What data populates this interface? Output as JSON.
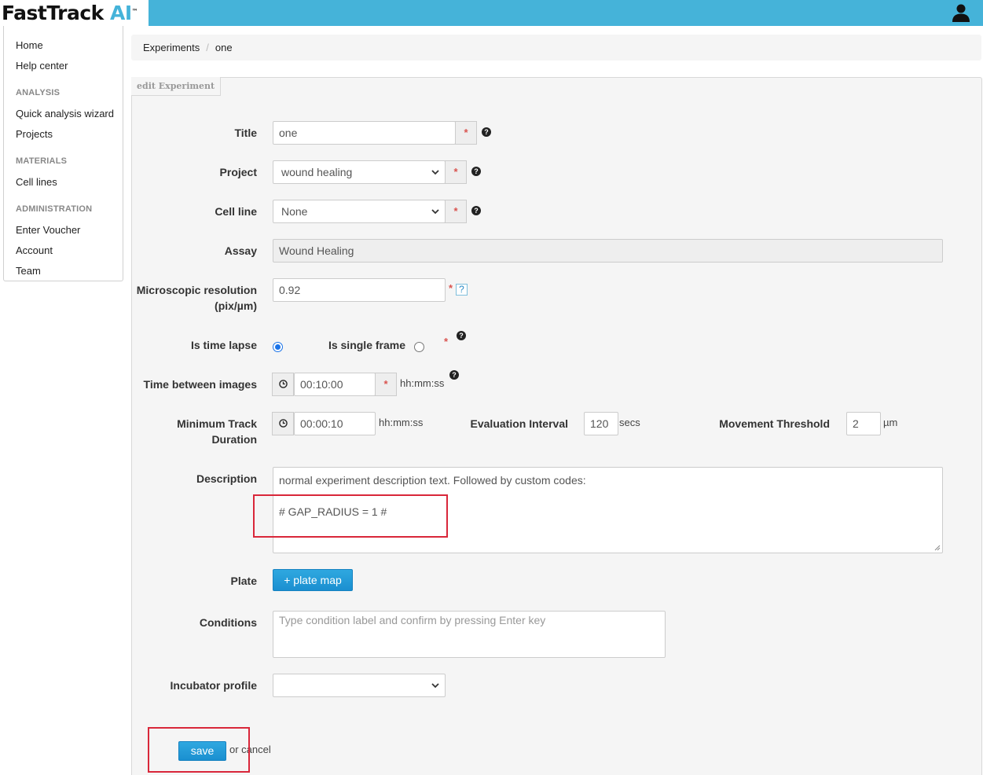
{
  "app": {
    "logo_text": "FastTrack",
    "logo_ai": "AI",
    "logo_tm": "™"
  },
  "sidebar": {
    "items": [
      {
        "label": "Home"
      },
      {
        "label": "Help center"
      }
    ],
    "sections": [
      {
        "title": "ANALYSIS",
        "items": [
          {
            "label": "Quick analysis wizard"
          },
          {
            "label": "Projects"
          }
        ]
      },
      {
        "title": "MATERIALS",
        "items": [
          {
            "label": "Cell lines"
          }
        ]
      },
      {
        "title": "ADMINISTRATION",
        "items": [
          {
            "label": "Enter Voucher"
          },
          {
            "label": "Account"
          },
          {
            "label": "Team"
          }
        ]
      }
    ]
  },
  "breadcrumb": {
    "items": [
      "Experiments",
      "one"
    ],
    "separator": "/"
  },
  "panel": {
    "tab_label": "edit Experiment"
  },
  "form": {
    "title": {
      "label": "Title",
      "value": "one"
    },
    "project": {
      "label": "Project",
      "value": "wound healing"
    },
    "cell_line": {
      "label": "Cell line",
      "value": "None"
    },
    "assay": {
      "label": "Assay",
      "value": "Wound Healing"
    },
    "resolution": {
      "label_line1": "Microscopic resolution",
      "label_line2": "(pix/µm)",
      "value": "0.92",
      "help": "?"
    },
    "time_lapse": {
      "label": "Is time lapse",
      "checked": true
    },
    "single_frame": {
      "label": "Is single frame",
      "checked": false
    },
    "time_between": {
      "label": "Time between images",
      "value": "00:10:00",
      "unit": "hh:mm:ss"
    },
    "min_track": {
      "label_line1": "Minimum Track",
      "label_line2": "Duration",
      "value": "00:00:10",
      "unit": "hh:mm:ss"
    },
    "eval_interval": {
      "label": "Evaluation Interval",
      "value": "120",
      "unit": "secs"
    },
    "movement": {
      "label": "Movement Threshold",
      "value": "2",
      "unit": "µm"
    },
    "description": {
      "label": "Description",
      "line1": "normal experiment description text. Followed by custom codes:",
      "line2": "# GAP_RADIUS = 1 #"
    },
    "plate": {
      "label": "Plate",
      "button": "+ plate map"
    },
    "conditions": {
      "label": "Conditions",
      "placeholder": "Type condition label and confirm by pressing Enter key"
    },
    "incubator": {
      "label": "Incubator profile",
      "value": ""
    },
    "required_mark": "*",
    "help_mark": "?"
  },
  "actions": {
    "save": "save",
    "or_cancel_prefix": "or ",
    "cancel": "cancel"
  },
  "colors": {
    "topbar": "#45b3d9",
    "accent": "#1a8fd0",
    "required": "#d9534f",
    "highlight": "#d9273a"
  }
}
